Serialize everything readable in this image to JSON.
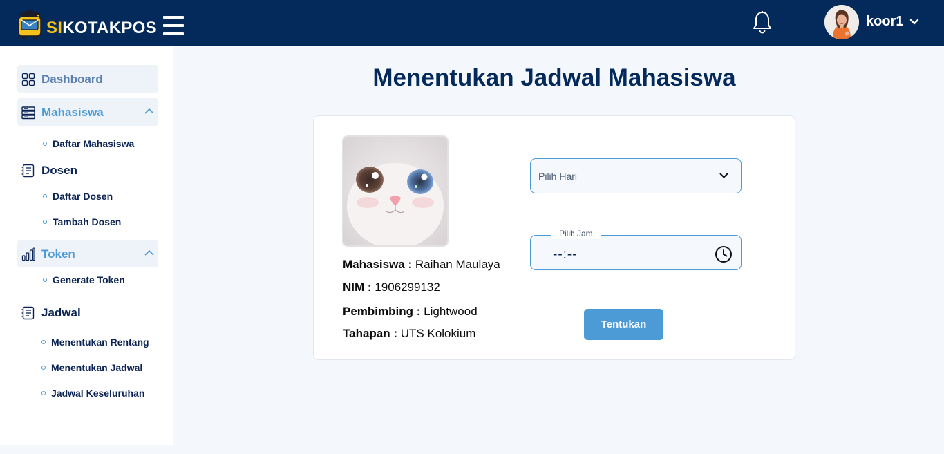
{
  "header": {
    "brand_prefix": "SI",
    "brand_suffix": "KOTAKPOS",
    "username": "koor1"
  },
  "sidebar": {
    "items": [
      {
        "label": "Dashboard",
        "icon": "grid-icon"
      },
      {
        "label": "Mahasiswa",
        "icon": "server-stack-icon",
        "expanded": true,
        "children": [
          "Daftar Mahasiswa"
        ]
      },
      {
        "label": "Dosen",
        "icon": "document-list-icon",
        "children": [
          "Daftar Dosen",
          "Tambah Dosen"
        ]
      },
      {
        "label": "Token",
        "icon": "bar-chart-icon",
        "expanded": true,
        "children": [
          "Generate Token"
        ]
      },
      {
        "label": "Jadwal",
        "icon": "document-list-icon",
        "children": [
          "Menentukan Rentang",
          "Menentukan Jadwal",
          "Jadwal Keseluruhan"
        ]
      }
    ]
  },
  "main": {
    "title": "Menentukan Jadwal Mahasiswa",
    "student": {
      "mahasiswa_label": "Mahasiswa :",
      "mahasiswa_value": "Raihan Maulaya",
      "nim_label": "NIM :",
      "nim_value": "1906299132",
      "pembimbing_label": "Pembimbing :",
      "pembimbing_value": "Lightwood",
      "tahapan_label": "Tahapan :",
      "tahapan_value": "UTS Kolokium"
    },
    "form": {
      "day_placeholder": "Pilih Hari",
      "time_label": "Pilih Jam",
      "time_value": "--:--",
      "submit_label": "Tentukan"
    }
  },
  "colors": {
    "header_bg": "#032a5b",
    "accent": "#4c9ad6",
    "brand_yellow": "#f4c21a",
    "page_bg": "#f4f7fc"
  }
}
